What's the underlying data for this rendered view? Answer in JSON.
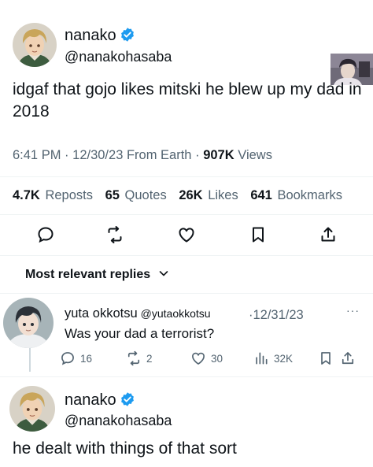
{
  "tweet": {
    "author_name": "nanako",
    "author_handle": "@nanakohasaba",
    "text": "idgaf that gojo likes mitski he blew up my dad in 2018",
    "time": "6:41 PM",
    "date": "12/30/23",
    "source": "From Earth",
    "views_count": "907K",
    "views_label": "Views",
    "reposts_count": "4.7K",
    "reposts_label": "Reposts",
    "quotes_count": "65",
    "quotes_label": "Quotes",
    "likes_count": "26K",
    "likes_label": "Likes",
    "bookmarks_count": "641",
    "bookmarks_label": "Bookmarks"
  },
  "actions": {
    "icons": [
      "reply-icon",
      "repost-icon",
      "like-icon",
      "bookmark-icon",
      "share-icon"
    ]
  },
  "replies_header": {
    "label": "Most relevant replies"
  },
  "reply": {
    "author_name": "yuta okkotsu",
    "author_handle": "@yutaokkotsu",
    "date": "12/31/23",
    "text": "Was your dad a terrorist?",
    "reply_count": "16",
    "repost_count": "2",
    "like_count": "30",
    "views_count": "32K"
  },
  "reply2": {
    "author_name": "nanako",
    "author_handle": "@nanakohasaba",
    "text": "he dealt with things of that sort"
  },
  "colors": {
    "verified": "#1d9bf0",
    "secondary_text": "#536471",
    "primary_text": "#0f1419",
    "divider": "#eff3f4"
  }
}
